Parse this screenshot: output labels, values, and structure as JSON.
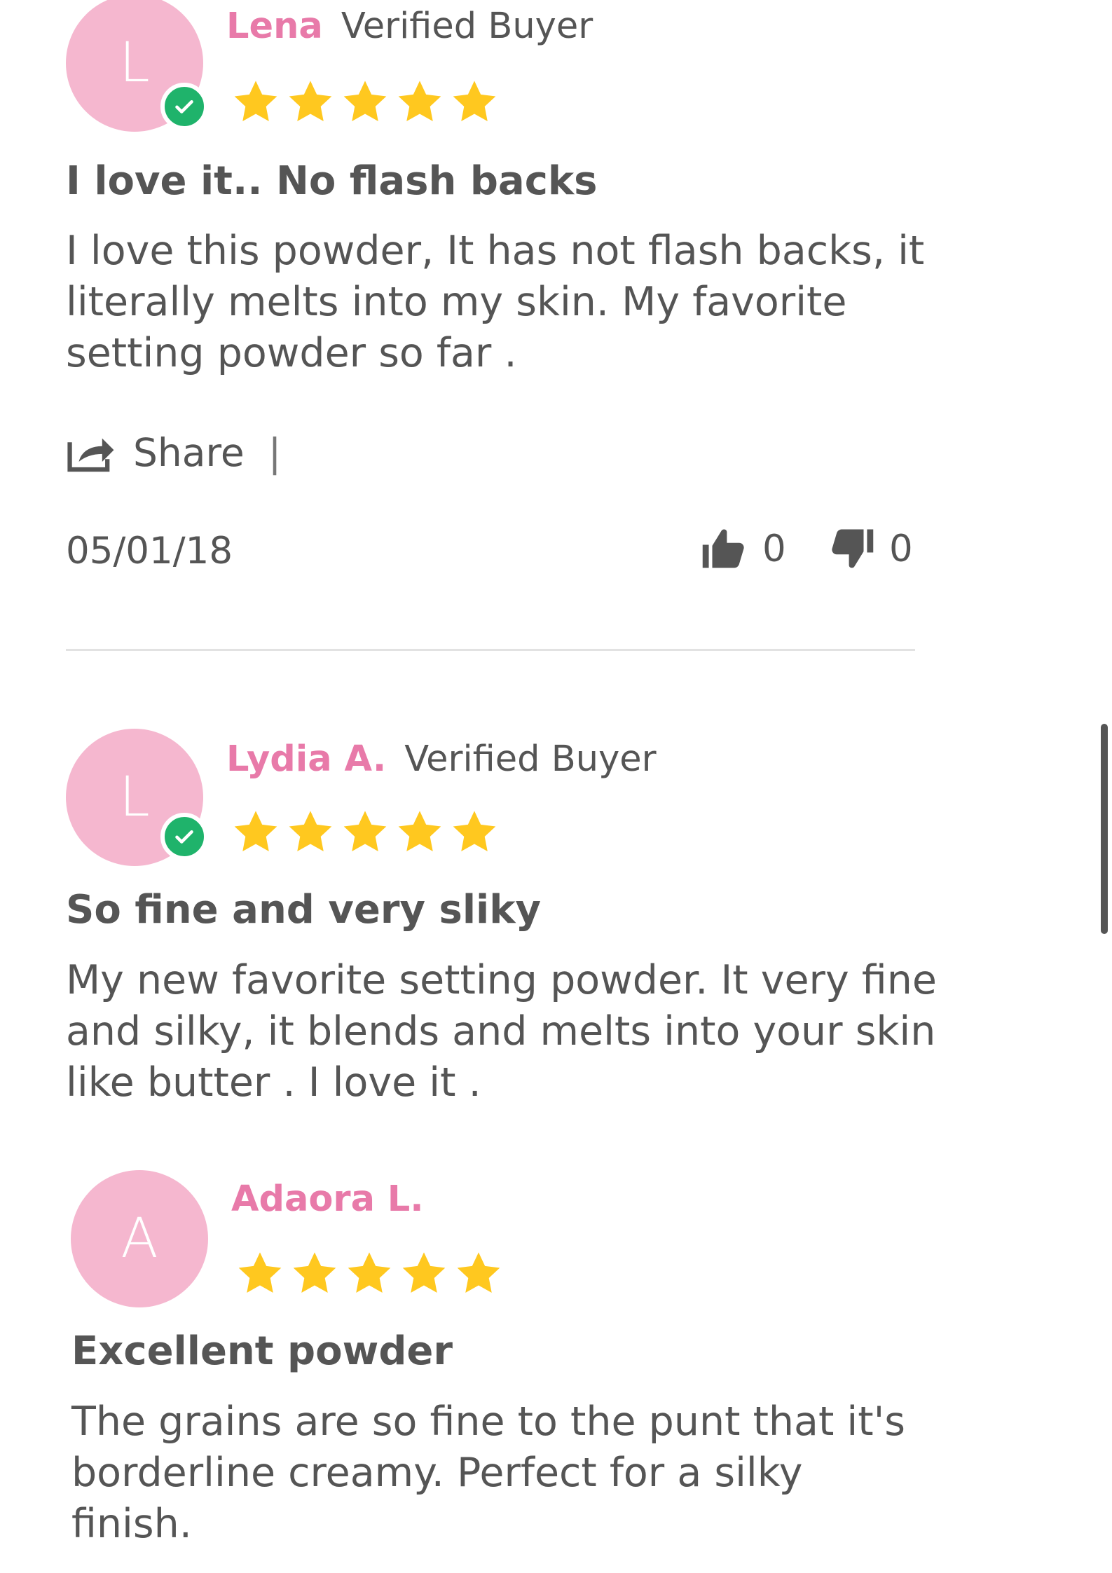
{
  "reviews": [
    {
      "avatar_letter": "L",
      "author": "Lena",
      "verified_label": "Verified Buyer",
      "rating": 5,
      "title": "I love it.. No flash backs",
      "body": "I love this powder, It has not flash backs, it literally melts into my skin. My favorite setting powder so far .",
      "share_label": "Share",
      "share_separator": "|",
      "date": "05/01/18",
      "thumbs_up_count": "0",
      "thumbs_down_count": "0"
    },
    {
      "avatar_letter": "L",
      "author": "Lydia A.",
      "verified_label": "Verified Buyer",
      "rating": 5,
      "title": "So fine and very sliky",
      "body": "My new favorite setting powder. It very fine and silky, it blends and melts into your skin like butter . I love it ."
    },
    {
      "avatar_letter": "A",
      "author": "Adaora L.",
      "rating": 5,
      "title": "Excellent powder",
      "body": "The grains are so fine to the punt that it's borderline creamy. Perfect for a silky finish."
    }
  ],
  "colors": {
    "avatar": "#f5b7cf",
    "author": "#e87aa9",
    "star": "#ffc81f",
    "verified_badge": "#1fb36b",
    "text": "#555555"
  },
  "icons": {
    "verified": "check-circle-icon",
    "star": "star-icon",
    "share": "share-icon",
    "thumbs_up": "thumbs-up-icon",
    "thumbs_down": "thumbs-down-icon"
  }
}
